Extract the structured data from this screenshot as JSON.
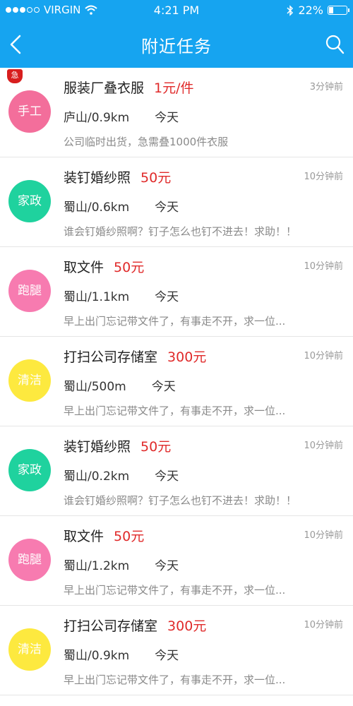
{
  "status_bar": {
    "carrier": "VIRGIN",
    "time": "4:21 PM",
    "battery": "22%",
    "battery_level": 0.22
  },
  "nav": {
    "title": "附近任务"
  },
  "colors": {
    "primary": "#16a4f0",
    "price": "#e02a2a",
    "urgent": "#d81e1e",
    "category_手工": "#f36e9b",
    "category_家政": "#1fd29e",
    "category_跑腿": "#f77bb0",
    "category_清洁": "#fde93f"
  },
  "tasks": [
    {
      "category": "手工",
      "avatar_color": "#f36e9b",
      "urgent": "急",
      "title": "服装厂叠衣服",
      "price": "1元/件",
      "time_ago": "3分钟前",
      "location": "庐山/0.9km",
      "date": "今天",
      "desc": "公司临时出货，急需叠1000件衣服"
    },
    {
      "category": "家政",
      "avatar_color": "#1fd29e",
      "title": "装钉婚纱照",
      "price": "50元",
      "time_ago": "10分钟前",
      "location": "蜀山/0.6km",
      "date": "今天",
      "desc": "谁会钉婚纱照啊？钉子怎么也钉不进去！求助！！"
    },
    {
      "category": "跑腿",
      "avatar_color": "#f77bb0",
      "title": "取文件",
      "price": "50元",
      "time_ago": "10分钟前",
      "location": "蜀山/1.1km",
      "date": "今天",
      "desc": "早上出门忘记带文件了，有事走不开，求一位..."
    },
    {
      "category": "清洁",
      "avatar_color": "#fde93f",
      "title": "打扫公司存储室",
      "price": "300元",
      "time_ago": "10分钟前",
      "location": "蜀山/500m",
      "date": "今天",
      "desc": "早上出门忘记带文件了，有事走不开，求一位..."
    },
    {
      "category": "家政",
      "avatar_color": "#1fd29e",
      "title": "装钉婚纱照",
      "price": "50元",
      "time_ago": "10分钟前",
      "location": "蜀山/0.2km",
      "date": "今天",
      "desc": "谁会钉婚纱照啊？钉子怎么也钉不进去！求助！！"
    },
    {
      "category": "跑腿",
      "avatar_color": "#f77bb0",
      "title": "取文件",
      "price": "50元",
      "time_ago": "10分钟前",
      "location": "蜀山/1.2km",
      "date": "今天",
      "desc": "早上出门忘记带文件了，有事走不开，求一位..."
    },
    {
      "category": "清洁",
      "avatar_color": "#fde93f",
      "title": "打扫公司存储室",
      "price": "300元",
      "time_ago": "10分钟前",
      "location": "蜀山/0.9km",
      "date": "今天",
      "desc": "早上出门忘记带文件了，有事走不开，求一位..."
    }
  ]
}
